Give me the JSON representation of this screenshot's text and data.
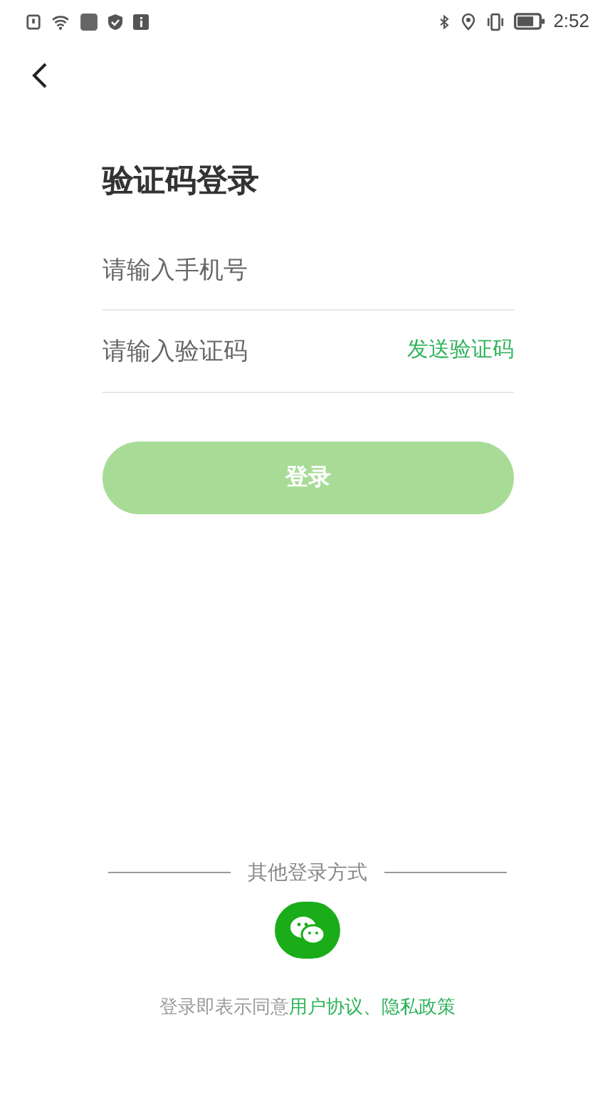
{
  "status_bar": {
    "time": "2:52"
  },
  "title": "验证码登录",
  "phone_field": {
    "placeholder": "请输入手机号"
  },
  "code_field": {
    "placeholder": "请输入验证码",
    "send_code": "发送验证码"
  },
  "login_button": {
    "label": "登录",
    "disabled": true
  },
  "other_login": {
    "label": "其他登录方式"
  },
  "agreement": {
    "text": "登录即表示同意",
    "links": [
      "用户协议",
      "隐私政策"
    ],
    "separator": "、"
  }
}
